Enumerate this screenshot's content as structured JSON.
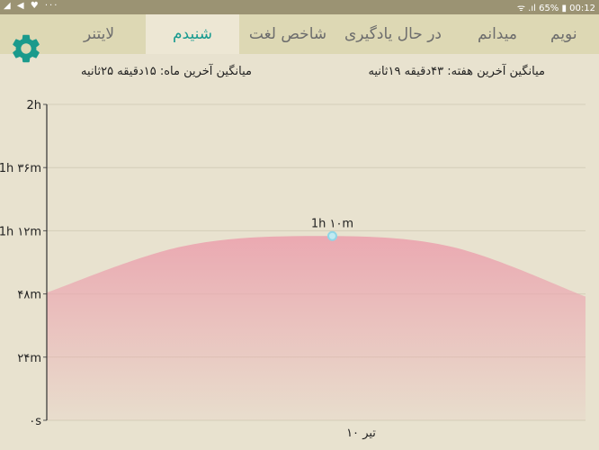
{
  "status_bar": {
    "left_text": "◢ ◀ ♥ ···",
    "right_text": "ᯤ .ıl 65% ▮ 00:12"
  },
  "tabs": [
    {
      "label": "نویم",
      "active": false
    },
    {
      "label": "میدانم",
      "active": false
    },
    {
      "label": "در حال یادگیری",
      "active": false
    },
    {
      "label": "شاخص لغت",
      "active": false
    },
    {
      "label": "شنیدم",
      "active": true
    },
    {
      "label": "لایتنر",
      "active": false
    }
  ],
  "icons": {
    "settings": "gear-icon"
  },
  "colors": {
    "accent": "#179a8f",
    "gear": "#1a9a8c",
    "area": "#eba6b0",
    "point": "#8fd6e6"
  },
  "averages": {
    "week": "میانگین آخرین هفته: ۴۳دقیقه ۱۹ثانیه",
    "month": "میانگین آخرین ماه: ۱۵دقیقه ۲۵ثانیه"
  },
  "chart_data": {
    "type": "area",
    "x_category": "۱۰ تیر",
    "yticks": [
      {
        "value": 0,
        "label": "۰s"
      },
      {
        "value": 24,
        "label": "۲۴m"
      },
      {
        "value": 48,
        "label": "۴۸m"
      },
      {
        "value": 72,
        "label": "1h ۱۲m"
      },
      {
        "value": 96,
        "label": "1h ۳۶m"
      },
      {
        "value": 120,
        "label": "2h"
      }
    ],
    "ylim": [
      0,
      120
    ],
    "xlim": [
      0,
      1
    ],
    "curve": {
      "x": [
        0,
        0.25,
        0.5,
        0.75,
        1.0
      ],
      "y": [
        48.5,
        66,
        70,
        66,
        47
      ]
    },
    "highlight": {
      "x": 0.53,
      "y": 70,
      "label": "1h ۱۰m"
    },
    "grid": true
  }
}
